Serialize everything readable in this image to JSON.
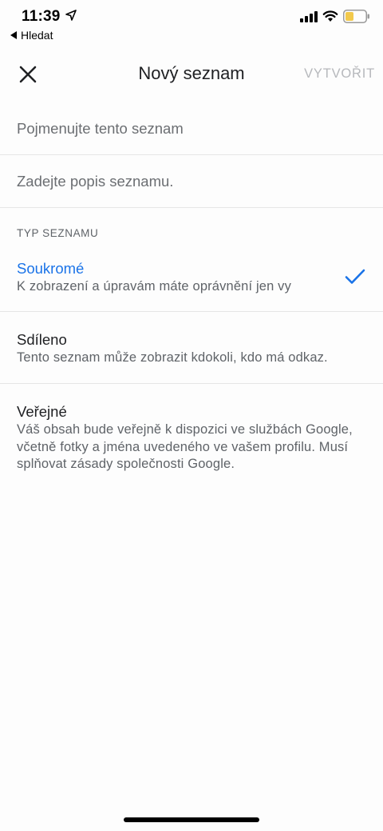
{
  "status_bar": {
    "time": "11:39",
    "back_app_label": "Hledat",
    "icons": [
      "location-arrow-icon",
      "signal-icon",
      "wifi-icon",
      "battery-icon"
    ],
    "battery_color": "#f2c94c"
  },
  "app_bar": {
    "close_icon": "close-icon",
    "title": "Nový seznam",
    "create_label": "VYTVOŘIT",
    "create_color": "#b6b8bc"
  },
  "form": {
    "name_placeholder": "Pojmenujte tento seznam",
    "name_value": "",
    "description_placeholder": "Zadejte popis seznamu.",
    "description_value": ""
  },
  "list_type": {
    "header": "TYP SEZNAMU",
    "accent_color": "#1a73e8",
    "options": [
      {
        "id": "private",
        "title": "Soukromé",
        "description": "K zobrazení a úpravám máte oprávnění jen vy",
        "selected": true
      },
      {
        "id": "shared",
        "title": "Sdíleno",
        "description": "Tento seznam může zobrazit kdokoli, kdo má odkaz.",
        "selected": false
      },
      {
        "id": "public",
        "title": "Veřejné",
        "description": "Váš obsah bude veřejně k dispozici ve službách Google, včetně fotky a jména uvedeného ve vašem profilu. Musí splňovat zásady společnosti Google.",
        "selected": false
      }
    ]
  }
}
